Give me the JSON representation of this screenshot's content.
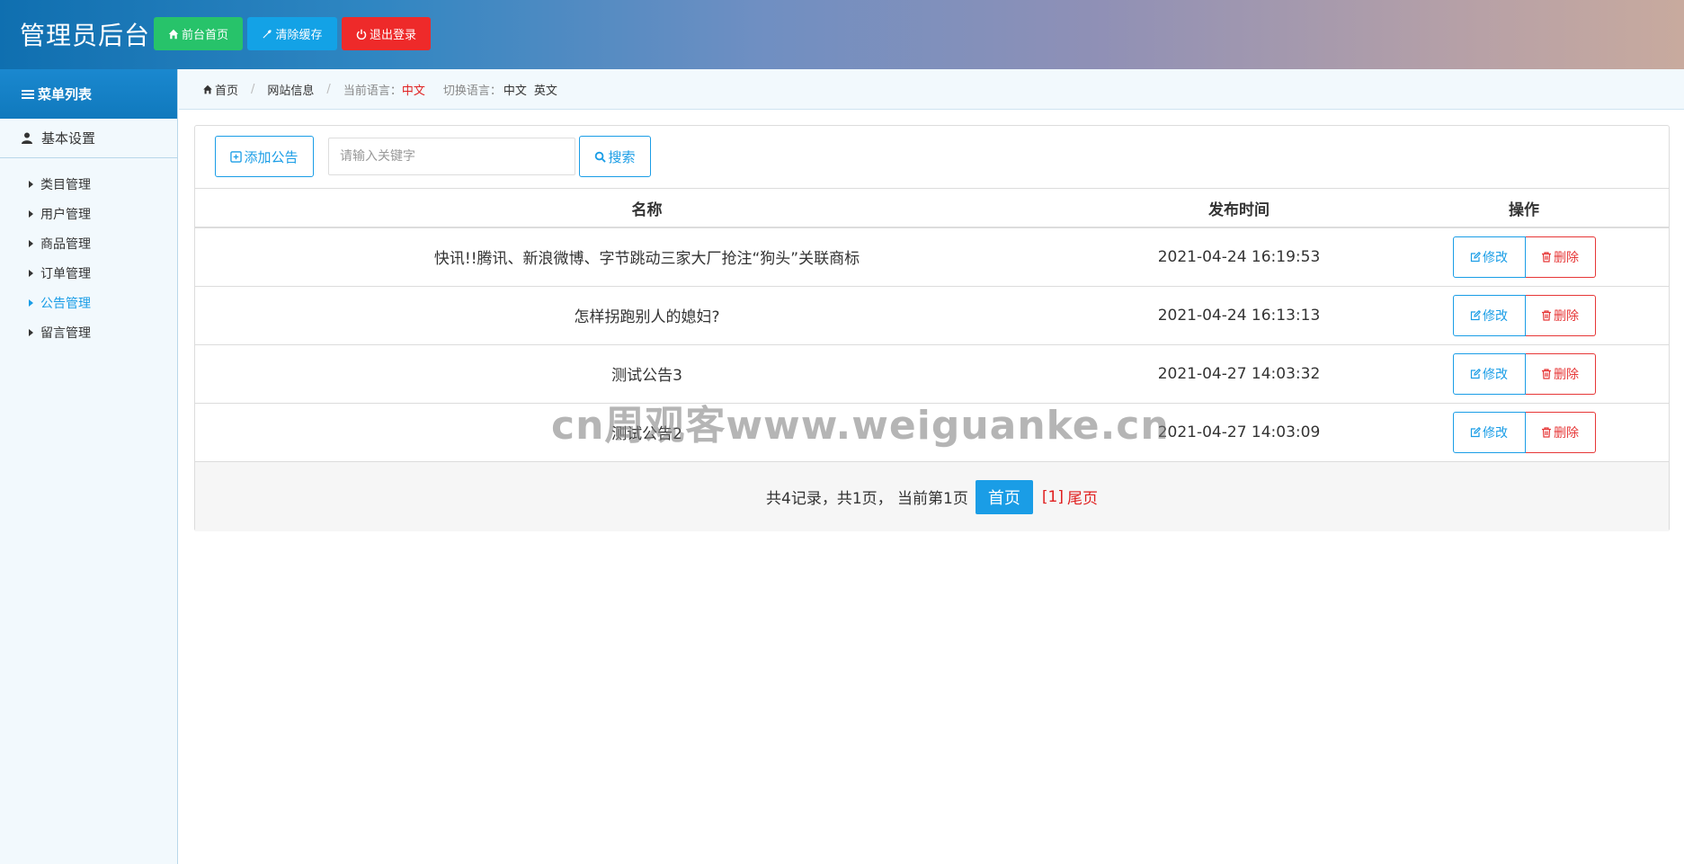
{
  "header": {
    "title": "管理员后台",
    "buttons": {
      "home": "前台首页",
      "clear_cache": "清除缓存",
      "logout": "退出登录"
    },
    "colors": {
      "home": "#27c36a",
      "cache": "#13a2e6",
      "logout": "#ee2a2a"
    }
  },
  "sidebar": {
    "heading": "菜单列表",
    "group": "基本设置",
    "items": [
      {
        "label": "类目管理",
        "active": false
      },
      {
        "label": "用户管理",
        "active": false
      },
      {
        "label": "商品管理",
        "active": false
      },
      {
        "label": "订单管理",
        "active": false
      },
      {
        "label": "公告管理",
        "active": true
      },
      {
        "label": "留言管理",
        "active": false
      }
    ]
  },
  "breadcrumb": {
    "home": "首页",
    "site_info": "网站信息",
    "current_lang_label": "当前语言：",
    "current_lang": "中文",
    "switch_lang_label": "切换语言：",
    "lang_zh": "中文",
    "lang_en": "英文"
  },
  "toolbar": {
    "add_label": "添加公告",
    "search_placeholder": "请输入关键字",
    "search_label": "搜索"
  },
  "table": {
    "columns": [
      "名称",
      "发布时间",
      "操作"
    ],
    "rows": [
      {
        "name": "快讯!!腾讯、新浪微博、字节跳动三家大厂抢注“狗头”关联商标",
        "time": "2021-04-24 16:19:53"
      },
      {
        "name": "怎样拐跑别人的媳妇?",
        "time": "2021-04-24 16:13:13"
      },
      {
        "name": "测试公告3",
        "time": "2021-04-27 14:03:32"
      },
      {
        "name": "测试公告2",
        "time": "2021-04-27 14:03:09"
      }
    ],
    "edit_label": "修改",
    "delete_label": "删除"
  },
  "pager": {
    "summary": "共4记录，共1页， 当前第1页",
    "first": "首页",
    "current": "[1]",
    "last": "尾页"
  },
  "watermark": "cn周观客www.weiguanke.cn"
}
